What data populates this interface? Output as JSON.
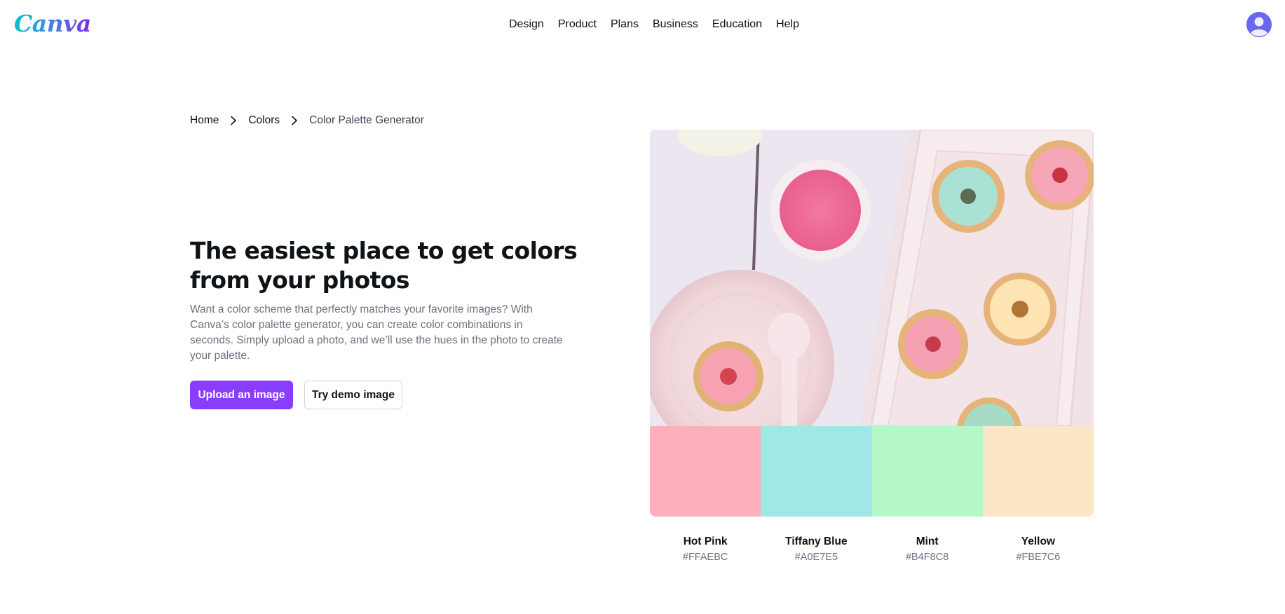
{
  "brand": {
    "logo_text": "Canva"
  },
  "nav": {
    "items": [
      "Design",
      "Product",
      "Plans",
      "Business",
      "Education",
      "Help"
    ]
  },
  "breadcrumb": {
    "home": "Home",
    "colors": "Colors",
    "current": "Color Palette Generator"
  },
  "hero": {
    "title": "The easiest place to get colors from your photos",
    "description": "Want a color scheme that perfectly matches your favorite images? With Canva’s color palette generator, you can create color combinations in seconds. Simply upload a photo, and we’ll use the hues in the photo to create your palette.",
    "upload_button": "Upload an image",
    "demo_button": "Try demo image"
  },
  "palette": [
    {
      "name": "Hot Pink",
      "hex": "#FFAEBC"
    },
    {
      "name": "Tiffany Blue",
      "hex": "#A0E7E5"
    },
    {
      "name": "Mint",
      "hex": "#B4F8C8"
    },
    {
      "name": "Yellow",
      "hex": "#FBE7C6"
    }
  ],
  "colors": {
    "accent": "#8B3DFF",
    "avatar": "#6A66F0"
  }
}
